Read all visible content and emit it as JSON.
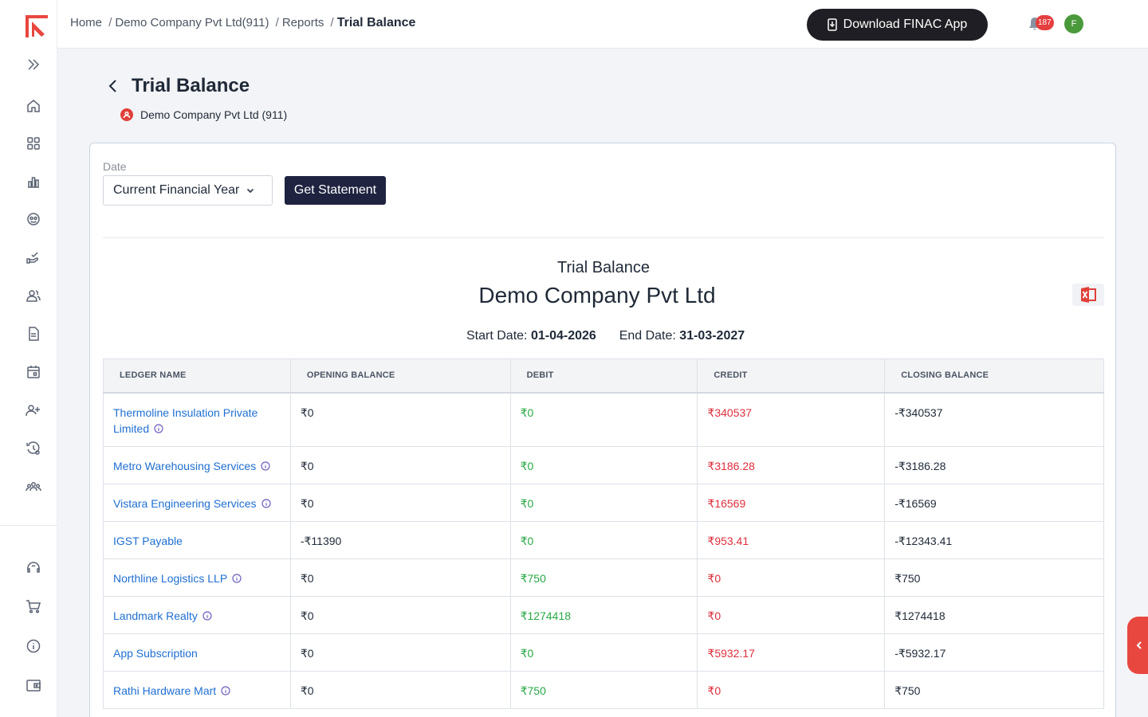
{
  "breadcrumb": {
    "home": "Home",
    "company": "Demo Company Pvt Ltd(911)",
    "reports": "Reports",
    "current": "Trial Balance",
    "separator": "/"
  },
  "header": {
    "download_label": "Download FINAC App",
    "notification_count": "187",
    "avatar_initial": "F"
  },
  "page": {
    "title": "Trial Balance",
    "company_label": "Demo Company Pvt Ltd (911)"
  },
  "filter": {
    "date_label": "Date",
    "date_value": "Current Financial Year",
    "get_statement_label": "Get Statement"
  },
  "report": {
    "subtitle": "Trial Balance",
    "company": "Demo Company Pvt Ltd",
    "start_label": "Start Date:",
    "start_value": "01-04-2026",
    "end_label": "End Date:",
    "end_value": "31-03-2027"
  },
  "table": {
    "headers": [
      "LEDGER NAME",
      "OPENING BALANCE",
      "DEBIT",
      "CREDIT",
      "CLOSING BALANCE"
    ],
    "rows": [
      {
        "name": "Thermoline Insulation Private Limited",
        "info": true,
        "opening": "₹0",
        "debit": "₹0",
        "credit": "₹340537",
        "closing": "-₹340537"
      },
      {
        "name": "Metro Warehousing Services",
        "info": true,
        "opening": "₹0",
        "debit": "₹0",
        "credit": "₹3186.28",
        "closing": "-₹3186.28"
      },
      {
        "name": "Vistara Engineering Services",
        "info": true,
        "opening": "₹0",
        "debit": "₹0",
        "credit": "₹16569",
        "closing": "-₹16569"
      },
      {
        "name": "IGST Payable",
        "info": false,
        "opening": "-₹11390",
        "debit": "₹0",
        "credit": "₹953.41",
        "closing": "-₹12343.41"
      },
      {
        "name": "Northline Logistics LLP",
        "info": true,
        "opening": "₹0",
        "debit": "₹750",
        "credit": "₹0",
        "closing": "₹750"
      },
      {
        "name": "Landmark Realty",
        "info": true,
        "opening": "₹0",
        "debit": "₹1274418",
        "credit": "₹0",
        "closing": "₹1274418"
      },
      {
        "name": "App Subscription",
        "info": false,
        "opening": "₹0",
        "debit": "₹0",
        "credit": "₹5932.17",
        "closing": "-₹5932.17"
      },
      {
        "name": "Rathi Hardware Mart",
        "info": true,
        "opening": "₹0",
        "debit": "₹750",
        "credit": "₹0",
        "closing": "₹750"
      }
    ]
  },
  "sidebar": {
    "icons": [
      "expand-icon",
      "home-icon",
      "apps-grid-icon",
      "reports-chart-icon",
      "accounts-icon",
      "payments-hand-icon",
      "customers-icon",
      "invoice-document-icon",
      "calendar-icon",
      "add-user-icon",
      "settings-history-icon",
      "team-icon",
      "support-headset-icon",
      "cart-icon",
      "info-icon",
      "wallet-icon"
    ]
  },
  "colors": {
    "accent": "#e8473f",
    "debit": "#27a844",
    "credit": "#de2e3b",
    "link": "#1f6fd1",
    "dark_button": "#1f2340"
  }
}
